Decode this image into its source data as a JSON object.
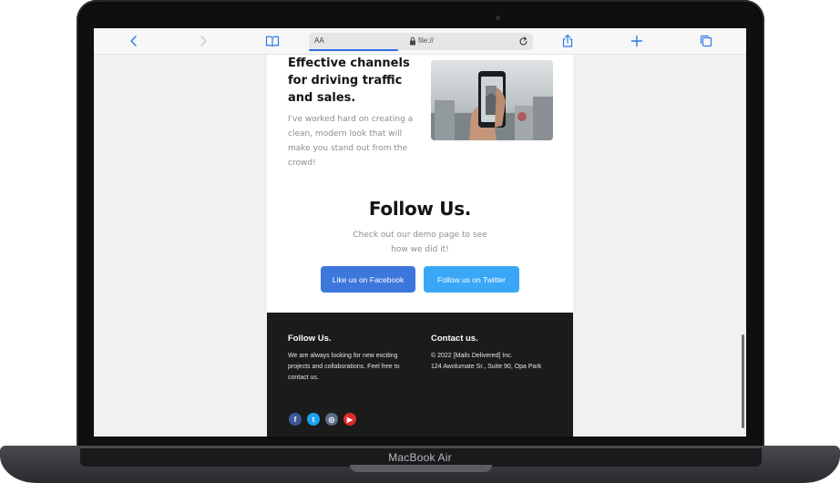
{
  "device": {
    "label": "MacBook Air"
  },
  "browser": {
    "reader_label": "AA",
    "url": "file://",
    "page_load_progress": 0.4,
    "icons": {
      "back": "chevron-left-icon",
      "forward": "chevron-right-icon",
      "bookmarks": "book-icon",
      "lock": "lock-icon",
      "reload": "reload-icon",
      "share": "share-icon",
      "new_tab": "plus-icon",
      "tabs": "tabs-icon"
    },
    "accent_color": "#2f6fe3"
  },
  "feature": {
    "title": "Effective channels for driving traffic and sales.",
    "text": "I've worked hard on creating a clean, modern look that will make you stand out from the crowd!",
    "image_icon": "smartphone-photo-image"
  },
  "follow": {
    "title": "Follow Us.",
    "text": "Check out our demo page to see how we did it!",
    "facebook_button": "Like us on Facebook",
    "twitter_button": "Follow us on Twitter",
    "facebook_color": "#3d77dc",
    "twitter_color": "#3aa7f6"
  },
  "footer": {
    "background": "#1b1b1b",
    "left_heading": "Follow Us.",
    "left_text": "We are always looking for new exciting projects and collaborations. Feel free to contact us.",
    "right_heading": "Contact us.",
    "copyright": "© 2022 [Mails Delivered] Inc.",
    "address": "124 Awolumate Sr., Suite 90, Opa Park",
    "social": [
      {
        "name": "facebook-icon",
        "glyph": "f",
        "color": "#3b5998"
      },
      {
        "name": "twitter-icon",
        "glyph": "t",
        "color": "#1da1f2"
      },
      {
        "name": "instagram-icon",
        "glyph": "◎",
        "color": "#5b6b86"
      },
      {
        "name": "youtube-icon",
        "glyph": "▶",
        "color": "#e02a2a"
      }
    ]
  }
}
